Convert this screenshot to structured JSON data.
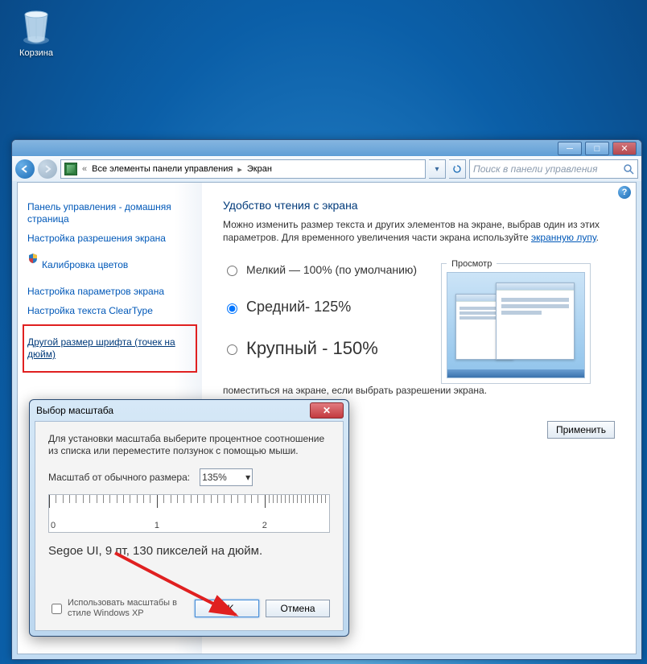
{
  "desktop": {
    "recycle_bin": "Корзина"
  },
  "window": {
    "breadcrumb1": "Все элементы панели управления",
    "breadcrumb2": "Экран",
    "search_placeholder": "Поиск в панели управления"
  },
  "sidenav": {
    "home": "Панель управления - домашняя страница",
    "resolution": "Настройка разрешения экрана",
    "calibration": "Калибровка цветов",
    "display_settings": "Настройка параметров экрана",
    "cleartype": "Настройка текста ClearType",
    "custom_dpi": "Другой размер шрифта (точек на дюйм)"
  },
  "main": {
    "heading": "Удобство чтения с экрана",
    "desc1": "Можно изменить размер текста и других элементов на экране, выбрав один из этих параметров. Для временного увеличения части экрана используйте ",
    "magnifier_link": "экранную лупу",
    "opt_small": "Мелкий — 100% (по умолчанию)",
    "opt_medium": "Средний- 125%",
    "opt_large": "Крупный - 150%",
    "preview_label": "Просмотр",
    "note": "поместиться на экране, если выбрать разрешении экрана.",
    "apply": "Применить"
  },
  "dialog": {
    "title": "Выбор масштаба",
    "instruction": "Для установки масштаба выберите процентное соотношение из списка или переместите ползунок с помощью мыши.",
    "scale_label": "Масштаб от обычного размера:",
    "scale_value": "135%",
    "ruler_0": "0",
    "ruler_1": "1",
    "ruler_2": "2",
    "sample": "Segoe UI, 9 пт, 130 пикселей на дюйм.",
    "xp_style": "Использовать масштабы в стиле Windows XP",
    "ok": "OK",
    "cancel": "Отмена"
  }
}
